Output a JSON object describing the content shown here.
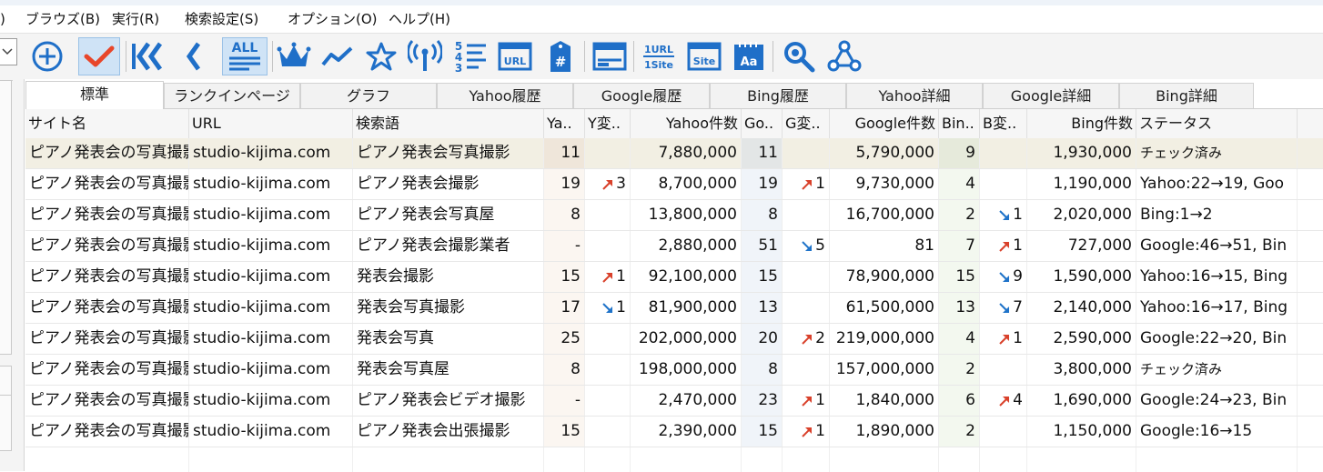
{
  "menu": [
    "ブラウズ(B)",
    "実行(R)",
    "検索設定(S)",
    "オプション(O)",
    "ヘルプ(H)"
  ],
  "menu_partial": ")",
  "toolbar": {
    "all_label": "ALL",
    "rank_digits": [
      "5",
      "4",
      "3"
    ],
    "url_label": "URL",
    "hash_label": "#",
    "one_url_label": "1URL",
    "one_site_label": "1Site",
    "site_label": "Site",
    "aa_label": "Aa"
  },
  "tabs": [
    "標準",
    "ランクインページ",
    "グラフ",
    "Yahoo履歴",
    "Google履歴",
    "Bing履歴",
    "Yahoo詳細",
    "Google詳細",
    "Bing詳細"
  ],
  "columns": [
    "サイト名",
    "URL",
    "検索語",
    "Ya..",
    "Y変..",
    "Yahoo件数",
    "Go..",
    "G変..",
    "Google件数",
    "Bin..",
    "B変..",
    "Bing件数",
    "ステータス"
  ],
  "colors": {
    "accent_blue": "#1f6fc8",
    "check_orange": "#e8462a",
    "up_arrow": "#d9412b",
    "down_arrow": "#1f73c9"
  },
  "rows": [
    {
      "site": "ピアノ発表会の写真撮影",
      "url": "studio-kijima.com",
      "kw": "ピアノ発表会写真撮影",
      "ya": "11",
      "ych": "",
      "ydir": "",
      "ycnt": "7,880,000",
      "go": "11",
      "gch": "",
      "gdir": "",
      "gcnt": "5,790,000",
      "bi": "9",
      "bch": "",
      "bdir": "",
      "bcnt": "1,930,000",
      "status": "チェック済み"
    },
    {
      "site": "ピアノ発表会の写真撮影",
      "url": "studio-kijima.com",
      "kw": "ピアノ発表会撮影",
      "ya": "19",
      "ych": "3",
      "ydir": "up",
      "ycnt": "8,700,000",
      "go": "19",
      "gch": "1",
      "gdir": "up",
      "gcnt": "9,730,000",
      "bi": "4",
      "bch": "",
      "bdir": "",
      "bcnt": "1,190,000",
      "status": "Yahoo:22→19, Goo"
    },
    {
      "site": "ピアノ発表会の写真撮影",
      "url": "studio-kijima.com",
      "kw": "ピアノ発表会写真屋",
      "ya": "8",
      "ych": "",
      "ydir": "",
      "ycnt": "13,800,000",
      "go": "8",
      "gch": "",
      "gdir": "",
      "gcnt": "16,700,000",
      "bi": "2",
      "bch": "1",
      "bdir": "down",
      "bcnt": "2,020,000",
      "status": "Bing:1→2"
    },
    {
      "site": "ピアノ発表会の写真撮影",
      "url": "studio-kijima.com",
      "kw": "ピアノ発表会撮影業者",
      "ya": "-",
      "ych": "",
      "ydir": "",
      "ycnt": "2,880,000",
      "go": "51",
      "gch": "5",
      "gdir": "down",
      "gcnt": "81",
      "bi": "7",
      "bch": "1",
      "bdir": "up",
      "bcnt": "727,000",
      "status": "Google:46→51, Bin"
    },
    {
      "site": "ピアノ発表会の写真撮影",
      "url": "studio-kijima.com",
      "kw": "発表会撮影",
      "ya": "15",
      "ych": "1",
      "ydir": "up",
      "ycnt": "92,100,000",
      "go": "15",
      "gch": "",
      "gdir": "",
      "gcnt": "78,900,000",
      "bi": "15",
      "bch": "9",
      "bdir": "down",
      "bcnt": "1,590,000",
      "status": "Yahoo:16→15, Bing"
    },
    {
      "site": "ピアノ発表会の写真撮影",
      "url": "studio-kijima.com",
      "kw": "発表会写真撮影",
      "ya": "17",
      "ych": "1",
      "ydir": "down",
      "ycnt": "81,900,000",
      "go": "13",
      "gch": "",
      "gdir": "",
      "gcnt": "61,500,000",
      "bi": "13",
      "bch": "7",
      "bdir": "down",
      "bcnt": "2,140,000",
      "status": "Yahoo:16→17, Bing"
    },
    {
      "site": "ピアノ発表会の写真撮影",
      "url": "studio-kijima.com",
      "kw": "発表会写真",
      "ya": "25",
      "ych": "",
      "ydir": "",
      "ycnt": "202,000,000",
      "go": "20",
      "gch": "2",
      "gdir": "up",
      "gcnt": "219,000,000",
      "bi": "4",
      "bch": "1",
      "bdir": "up",
      "bcnt": "2,590,000",
      "status": "Google:22→20, Bin"
    },
    {
      "site": "ピアノ発表会の写真撮影",
      "url": "studio-kijima.com",
      "kw": "発表会写真屋",
      "ya": "8",
      "ych": "",
      "ydir": "",
      "ycnt": "198,000,000",
      "go": "8",
      "gch": "",
      "gdir": "",
      "gcnt": "157,000,000",
      "bi": "2",
      "bch": "",
      "bdir": "",
      "bcnt": "3,800,000",
      "status": "チェック済み"
    },
    {
      "site": "ピアノ発表会の写真撮影",
      "url": "studio-kijima.com",
      "kw": "ピアノ発表会ビデオ撮影",
      "ya": "-",
      "ych": "",
      "ydir": "",
      "ycnt": "2,470,000",
      "go": "23",
      "gch": "1",
      "gdir": "up",
      "gcnt": "1,840,000",
      "bi": "6",
      "bch": "4",
      "bdir": "up",
      "bcnt": "1,690,000",
      "status": "Google:24→23, Bin"
    },
    {
      "site": "ピアノ発表会の写真撮影",
      "url": "studio-kijima.com",
      "kw": "ピアノ発表会出張撮影",
      "ya": "15",
      "ych": "",
      "ydir": "",
      "ycnt": "2,390,000",
      "go": "15",
      "gch": "1",
      "gdir": "up",
      "gcnt": "1,890,000",
      "bi": "2",
      "bch": "",
      "bdir": "",
      "bcnt": "1,150,000",
      "status": "Google:16→15"
    }
  ]
}
